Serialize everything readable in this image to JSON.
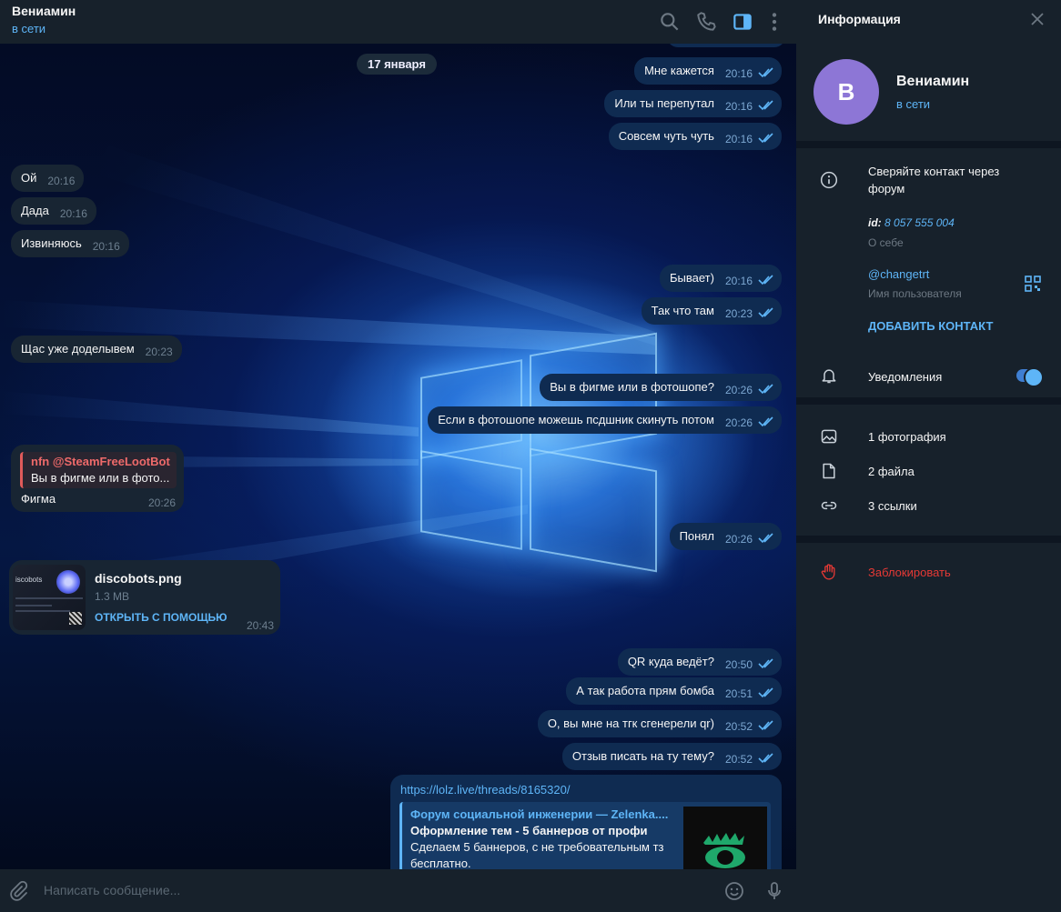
{
  "header": {
    "name": "Вениамин",
    "status": "в сети"
  },
  "date_pill": "17 января",
  "messages": [
    {
      "dir": "out",
      "text": "Мне кажется",
      "time": "20:16"
    },
    {
      "dir": "out",
      "text": "Или ты перепутал",
      "time": "20:16"
    },
    {
      "dir": "out",
      "text": "Совсем чуть чуть",
      "time": "20:16"
    },
    {
      "dir": "in",
      "text": "Ой",
      "time": "20:16"
    },
    {
      "dir": "in",
      "text": "Дада",
      "time": "20:16"
    },
    {
      "dir": "in",
      "text": "Извиняюсь",
      "time": "20:16"
    },
    {
      "dir": "out",
      "text": "Бывает)",
      "time": "20:16"
    },
    {
      "dir": "out",
      "text": "Так что там",
      "time": "20:23"
    },
    {
      "dir": "in",
      "text": "Щас уже доделывем",
      "time": "20:23"
    },
    {
      "dir": "out",
      "text": "Вы в фигме или в фотошопе?",
      "time": "20:26"
    },
    {
      "dir": "out",
      "text": "Если в фотошопе можешь псдшник скинуть потом",
      "time": "20:26"
    },
    {
      "dir": "out",
      "text": "Понял",
      "time": "20:26"
    },
    {
      "dir": "out",
      "text": "QR куда ведёт?",
      "time": "20:50"
    },
    {
      "dir": "out",
      "text": "А так работа прям бомба",
      "time": "20:51"
    },
    {
      "dir": "out",
      "text": "О, вы мне на тгк сгенерели qr)",
      "time": "20:52"
    },
    {
      "dir": "out",
      "text": "Отзыв писать на ту тему?",
      "time": "20:52"
    }
  ],
  "reply": {
    "author": "nfn @SteamFreeLootBot",
    "quote": "Вы в фигме или в фото...",
    "text": "Фигма",
    "time": "20:26"
  },
  "file": {
    "name": "discobots.png",
    "size": "1.3 MB",
    "action": "ОТКРЫТЬ С ПОМОЩЬЮ",
    "time": "20:43",
    "thumb_label": "iscobots"
  },
  "link_msg": {
    "url": "https://lolz.live/threads/8165320/",
    "site": "Форум социальной инженерии — Zelenka....",
    "title": "Оформление тем - 5 баннеров от профи",
    "desc1": "Сделаем 5 баннеров, с не требовательным тз",
    "desc2": "бесплатно."
  },
  "input": {
    "placeholder": "Написать сообщение..."
  },
  "info": {
    "title": "Информация",
    "avatar_letter": "В",
    "name": "Вениамин",
    "status": "в сети",
    "bio_line1": "Сверяйте контакт через",
    "bio_line2": "форум",
    "id_label": "id:",
    "id_value": "8 057 555 004",
    "about_label": "О себе",
    "username": "@changetrt",
    "username_label": "Имя пользователя",
    "add_contact": "ДОБАВИТЬ КОНТАКТ",
    "notifications": "Уведомления",
    "notifications_on": true,
    "photos": "1 фотография",
    "files": "2 файла",
    "links": "3 ссылки",
    "block": "Заблокировать"
  },
  "colors": {
    "bg": "#0e1621",
    "panel": "#17212b",
    "accent": "#5eb5f7",
    "out_bubble": "#0f2b51",
    "in_bubble": "#182533",
    "danger": "#e53935",
    "avatar": "#8d76d6"
  }
}
